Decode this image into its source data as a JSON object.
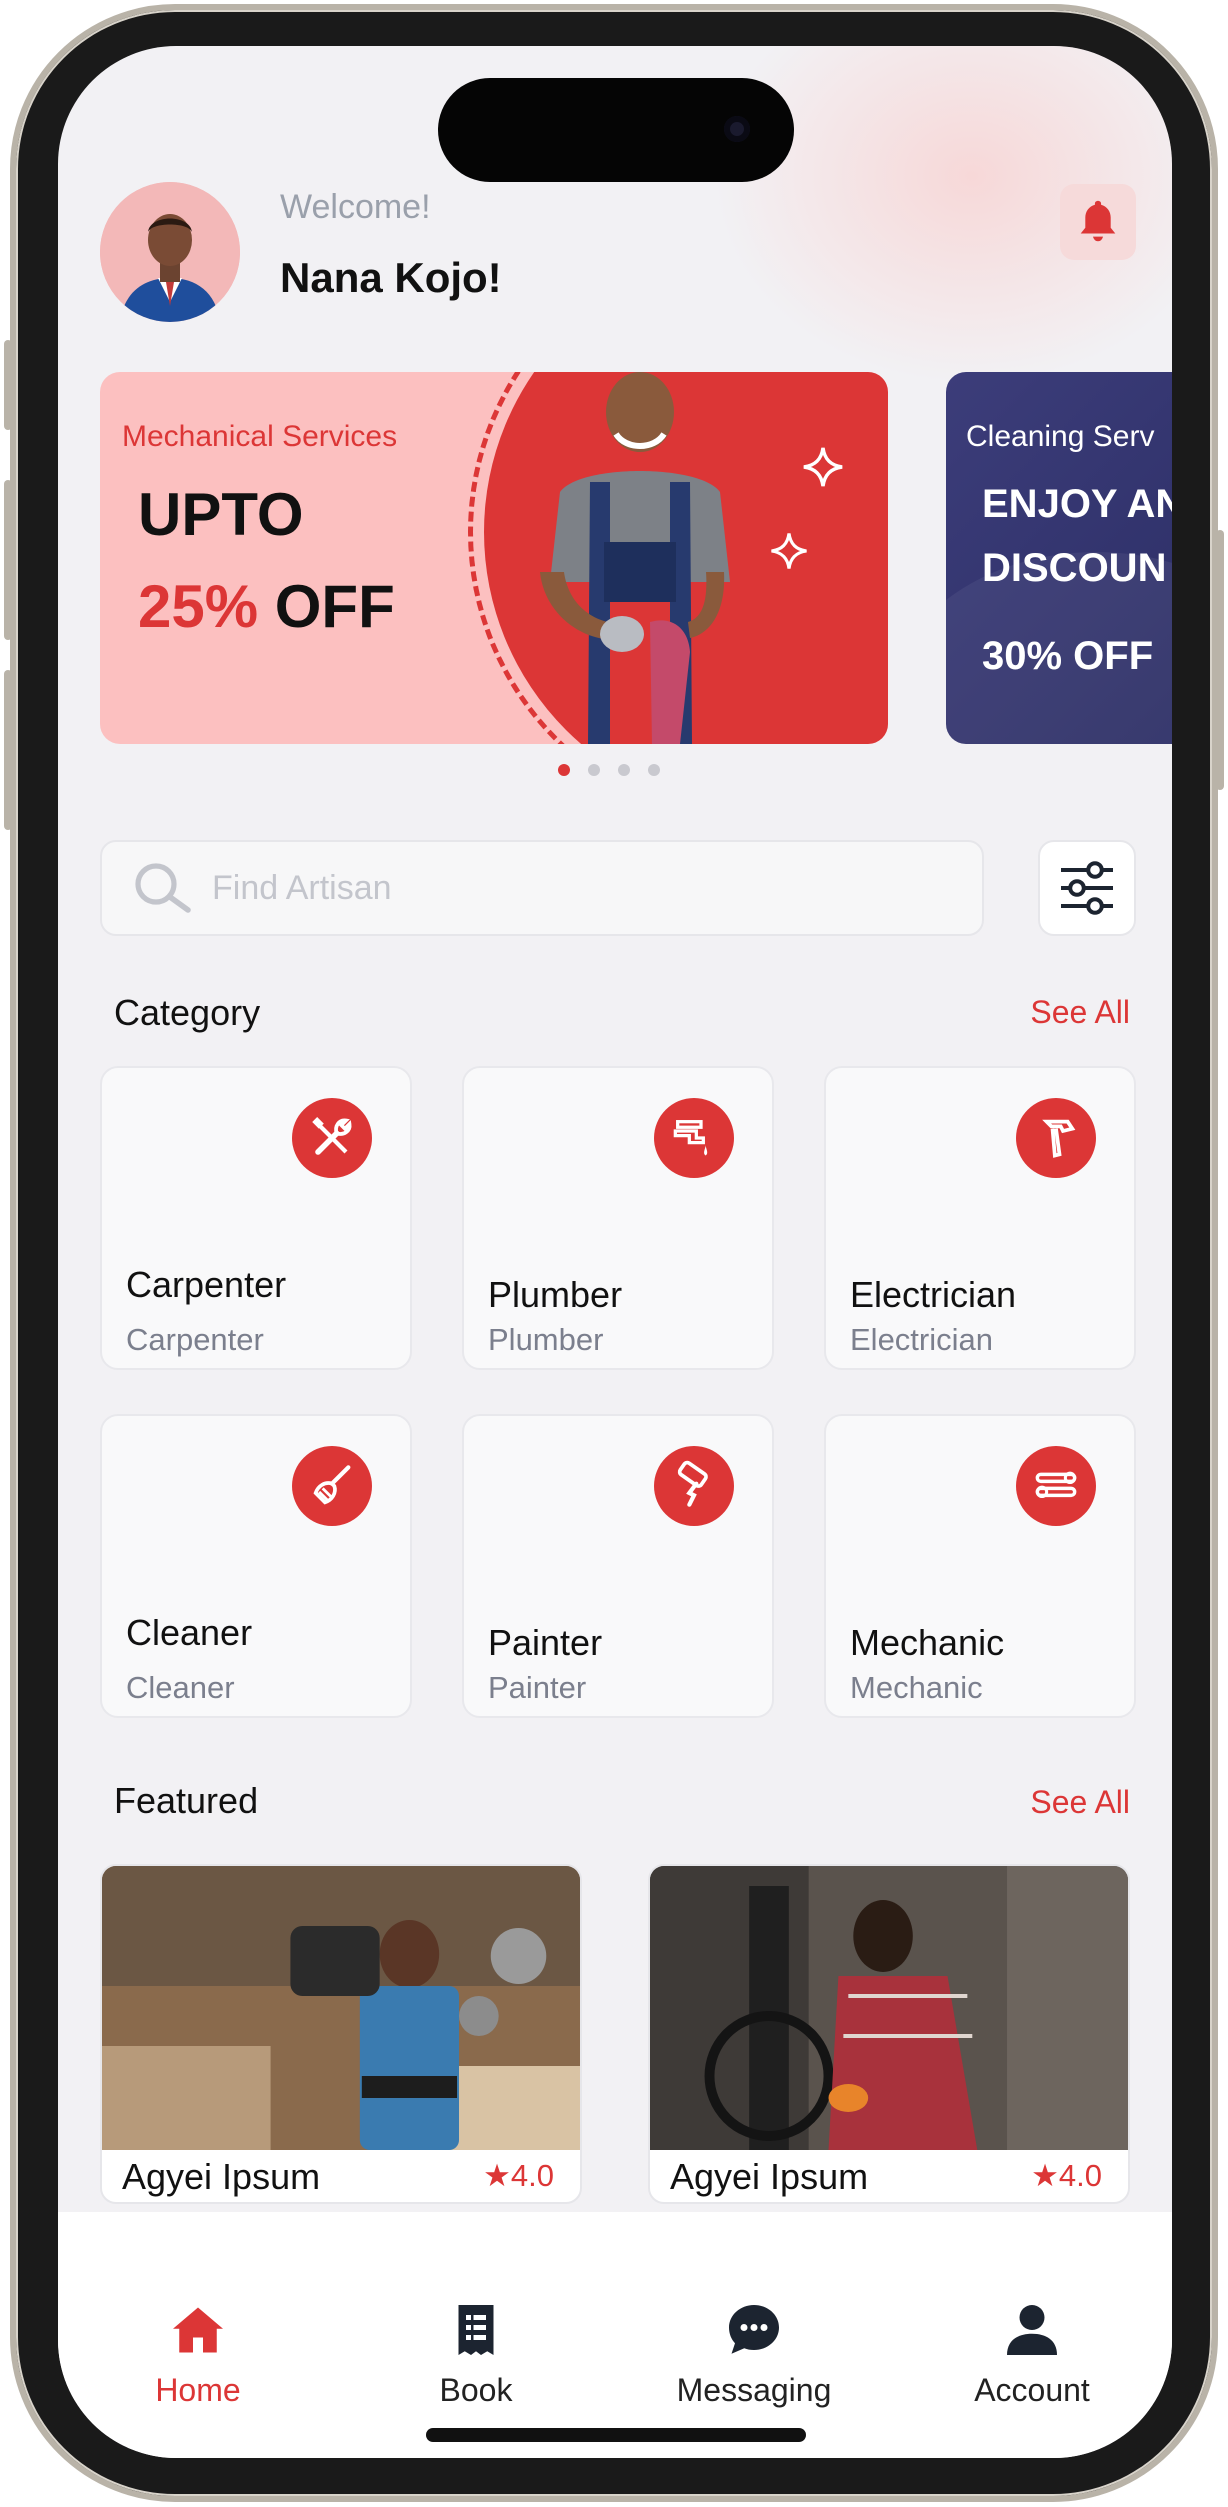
{
  "header": {
    "welcome": "Welcome!",
    "user_name": "Nana Kojo!"
  },
  "banners": [
    {
      "subtitle": "Mechanical Services",
      "line1": "UPTO",
      "percent": "25%",
      "off": "OFF"
    },
    {
      "subtitle": "Cleaning Serv",
      "line1": "ENJOY AN",
      "line2": "DISCOUN",
      "offer": "30% OFF"
    }
  ],
  "carousel": {
    "dot_count": 4,
    "active_index": 0
  },
  "search": {
    "placeholder": "Find Artisan"
  },
  "category": {
    "title": "Category",
    "see_all": "See All",
    "items": [
      {
        "name": "Carpenter",
        "sub": "Carpenter",
        "icon": "tools-icon"
      },
      {
        "name": "Plumber",
        "sub": "Plumber",
        "icon": "faucet-icon"
      },
      {
        "name": "Electrician",
        "sub": "Electrician",
        "icon": "hammer-icon"
      },
      {
        "name": "Cleaner",
        "sub": "Cleaner",
        "icon": "broom-icon"
      },
      {
        "name": "Painter",
        "sub": "Painter",
        "icon": "paint-roller-icon"
      },
      {
        "name": "Mechanic",
        "sub": "Mechanic",
        "icon": "wrench-icon"
      }
    ]
  },
  "featured": {
    "title": "Featured",
    "see_all": "See All",
    "items": [
      {
        "name": "Agyei Ipsum",
        "rating": "★4.0"
      },
      {
        "name": "Agyei Ipsum",
        "rating": "★4.0"
      }
    ]
  },
  "tabbar": {
    "items": [
      {
        "label": "Home",
        "icon": "home-icon",
        "active": true
      },
      {
        "label": "Book",
        "icon": "book-icon",
        "active": false
      },
      {
        "label": "Messaging",
        "icon": "chat-icon",
        "active": false
      },
      {
        "label": "Account",
        "icon": "person-icon",
        "active": false
      }
    ]
  },
  "colors": {
    "accent": "#dc3636",
    "banner_pink": "#fcc0c0",
    "banner_navy": "#2a2c63",
    "background": "#f2f1f4"
  }
}
